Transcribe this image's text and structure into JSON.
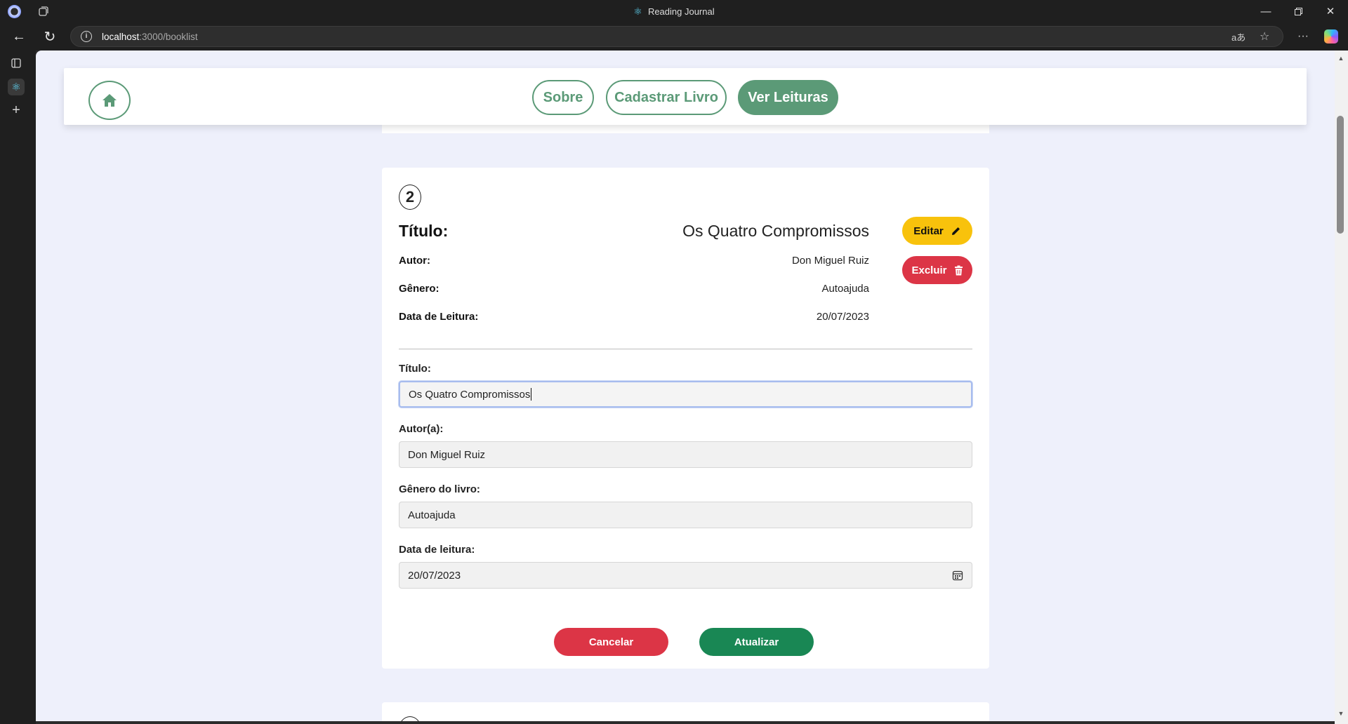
{
  "browser": {
    "window_title": "Reading Journal",
    "url_host": "localhost",
    "url_path": ":3000/booklist"
  },
  "nav": {
    "links": [
      "Sobre",
      "Cadastrar Livro",
      "Ver Leituras"
    ],
    "active": "Ver Leituras"
  },
  "book": {
    "number": "2",
    "title_label": "Título:",
    "title_value": "Os Quatro Compromissos",
    "author_label": "Autor:",
    "author_value": "Don Miguel Ruiz",
    "genre_label": "Gênero:",
    "genre_value": "Autoajuda",
    "date_label": "Data de Leitura:",
    "date_value": "20/07/2023",
    "edit_label": "Editar",
    "delete_label": "Excluir"
  },
  "form": {
    "title_label": "Título:",
    "title_value": "Os Quatro Compromissos",
    "author_label": "Autor(a):",
    "author_value": "Don Miguel Ruiz",
    "genre_label": "Gênero do livro:",
    "genre_value": "Autoajuda",
    "date_label": "Data de leitura:",
    "date_value": "20/07/2023",
    "cancel_label": "Cancelar",
    "update_label": "Atualizar"
  },
  "colors": {
    "brand_green": "#5b9a77",
    "edit_yellow": "#f8c20c",
    "danger_red": "#dc3546",
    "success_green": "#198754",
    "page_bg": "#eef0fb"
  }
}
